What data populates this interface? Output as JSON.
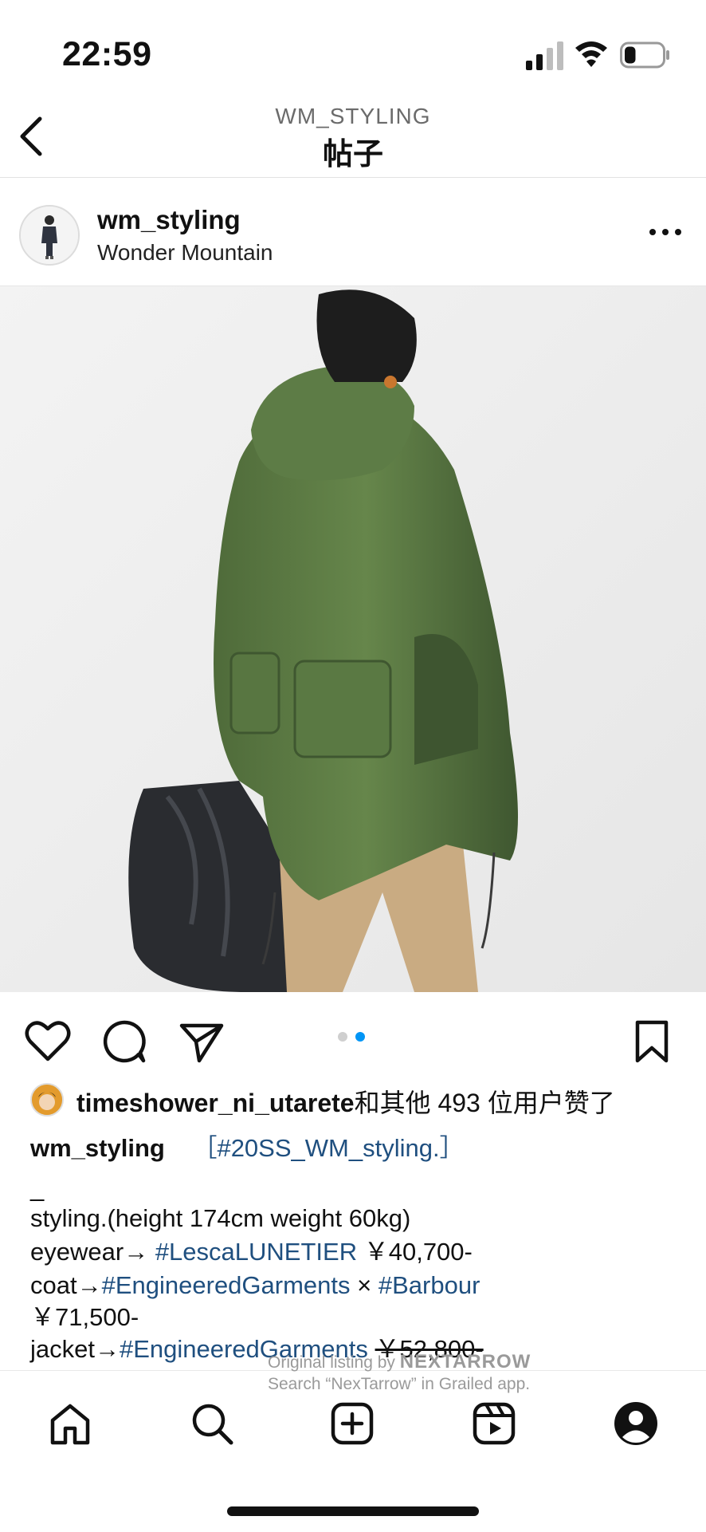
{
  "status": {
    "time": "22:59",
    "battery_level": 0.3
  },
  "nav": {
    "subtitle": "WM_STYLING",
    "title": "帖子"
  },
  "post": {
    "username": "wm_styling",
    "location": "Wonder Mountain",
    "carousel": {
      "count": 2,
      "active_index": 1
    },
    "liked_by": "timeshower_ni_utarete",
    "liked_rest": "和其他 493 位用户赞了",
    "caption": {
      "username": "wm_styling",
      "tag_bracket_open": "［",
      "tag": "#20SS_WM_styling.",
      "tag_bracket_close": "］",
      "dash": "_",
      "line_styling": "styling.(height 174cm weight 60kg)",
      "eyewear_label": "eyewear→",
      "eyewear_tag": "#LescaLUNETIER",
      "eyewear_price": "￥40,700-",
      "coat_label": "coat→",
      "coat_tag1": "#EngineeredGarments",
      "coat_times": "×",
      "coat_tag2": "#Barbour",
      "coat_price": "￥71,500-",
      "jacket_label": "jacket→",
      "jacket_tag": "#EngineeredGarments",
      "jacket_price": "￥52,800-"
    }
  },
  "watermark": {
    "line1_prefix": "Original listing by",
    "line1_brand": "NEXTARROW",
    "line2": "Search “NexTarrow” in Grailed app."
  },
  "tabs": [
    "home-icon",
    "search-icon",
    "new-post-icon",
    "reels-icon",
    "profile-icon"
  ],
  "colors": {
    "accent": "#0095f6",
    "link": "#1f4f7f",
    "coat_green": "#5c7a44"
  }
}
